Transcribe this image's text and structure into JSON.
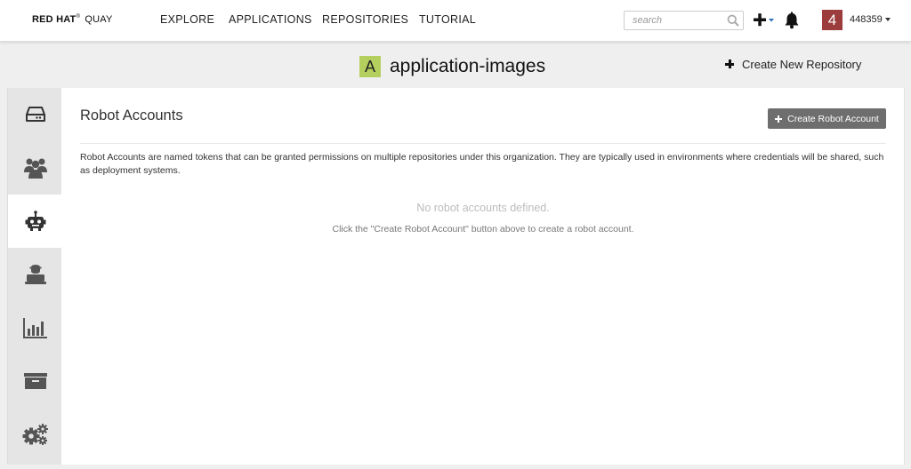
{
  "navbar": {
    "brand_red_hat": "RED HAT",
    "brand_tm": "®",
    "brand_quay": "QUAY",
    "links": [
      "EXPLORE",
      "APPLICATIONS",
      "REPOSITORIES",
      "TUTORIAL"
    ],
    "search_placeholder": "search",
    "notification_badge": "4",
    "username": "448359"
  },
  "header": {
    "org_avatar_letter": "A",
    "org_name": "application-images",
    "create_repo_label": "Create New Repository"
  },
  "sidebar": {
    "tabs": [
      {
        "icon": "repositories-icon",
        "active": false
      },
      {
        "icon": "teams-icon",
        "active": false
      },
      {
        "icon": "robot-icon",
        "active": true
      },
      {
        "icon": "default-permissions-icon",
        "active": false
      },
      {
        "icon": "usage-logs-icon",
        "active": false
      },
      {
        "icon": "applications-icon",
        "active": false
      },
      {
        "icon": "settings-icon",
        "active": false
      }
    ]
  },
  "main": {
    "title": "Robot Accounts",
    "create_button_label": "Create Robot Account",
    "description": "Robot Accounts are named tokens that can be granted permissions on multiple repositories under this organization. They are typically used in environments where credentials will be shared, such as deployment systems.",
    "empty_title": "No robot accounts defined.",
    "empty_hint": "Click the \"Create Robot Account\" button above to create a robot account."
  },
  "colors": {
    "avatar_bg": "#9c3c3c",
    "org_avatar_bg": "#b5cf5f",
    "button_bg": "#6e6e6e",
    "sidebar_bg": "#e5e5e5",
    "page_bg": "#efefef"
  }
}
